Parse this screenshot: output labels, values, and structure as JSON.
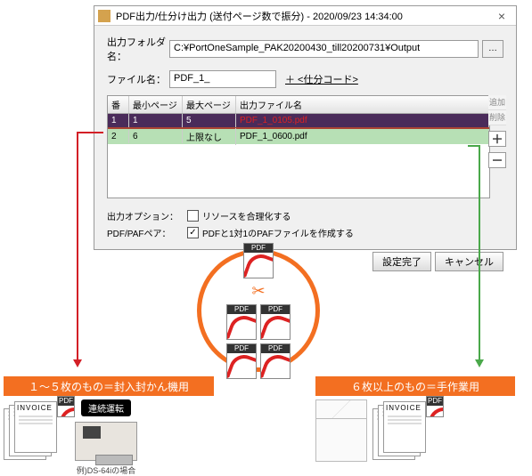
{
  "dialog": {
    "title": "PDF出力/仕分け出力 (送付ページ数で振分) - 2020/09/23 14:34:00",
    "outputFolderLabel": "出力フォルダ名：",
    "outputFolderValue": "C:¥PortOneSample_PAK20200430_till20200731¥Output",
    "browseBtn": "…",
    "fileNameLabel": "ファイル名：",
    "fileNameValue": "PDF_1_",
    "sortCodeLink": "＋ <仕分コード>",
    "headers": {
      "num": "番",
      "min": "最小ページ",
      "max": "最大ページ",
      "file": "出力ファイル名"
    },
    "rows": [
      {
        "num": "1",
        "min": "1",
        "max": "5",
        "file": "PDF_1_0105.pdf",
        "state": "sel"
      },
      {
        "num": "2",
        "min": "6",
        "max": "上限なし",
        "file": "PDF_1_0600.pdf",
        "state": "green"
      }
    ],
    "sideButtons": {
      "add": "追加",
      "del": "削除",
      "plus": "＋",
      "minus": "－"
    },
    "opts": {
      "outOptLabel": "出力オプション：",
      "rationalize": "リソースを合理化する",
      "rationalizeChecked": false,
      "pairLabel": "PDF/PAFペア：",
      "pair": "PDFと1対1のPAFファイルを作成する",
      "pairChecked": true
    },
    "buttons": {
      "ok": "設定完了",
      "cancel": "キャンセル"
    }
  },
  "circle": {
    "scissors": "✂",
    "pdf": "PDF"
  },
  "labels": {
    "left": "１～５枚のもの＝封入封かん機用",
    "right": "６枚以上のもの＝手作業用"
  },
  "illu": {
    "invoice": "INVOICE",
    "badge": "連続運転",
    "caption": "例)DS-64iの場合"
  }
}
